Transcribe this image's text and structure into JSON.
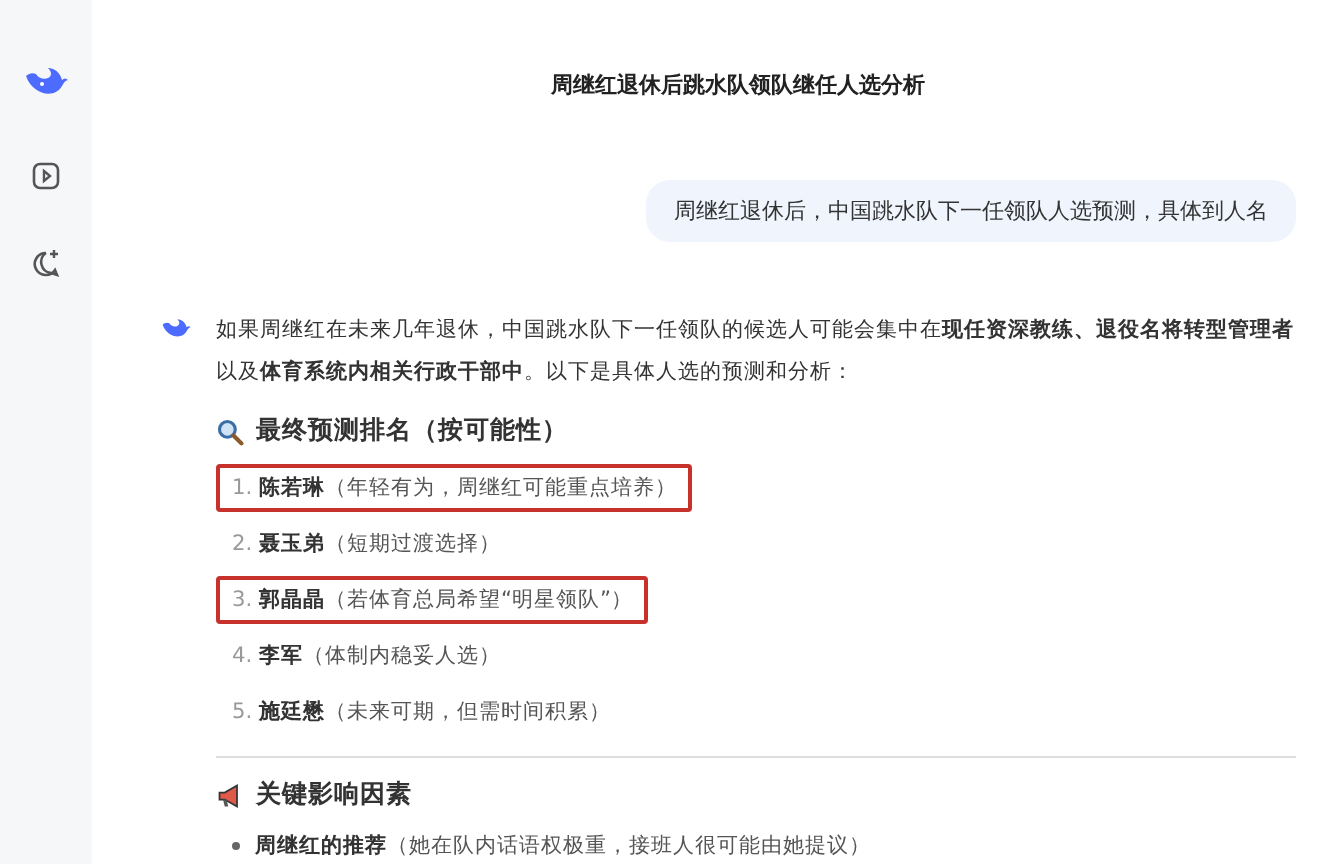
{
  "title": "周继红退休后跳水队领队继任人选分析",
  "user_message": "周继红退休后，中国跳水队下一任领队人选预测，具体到人名",
  "answer": {
    "intro": "如果周继红在未来几年退休，中国跳水队下一任领队的候选人可能会集中在**现任资深教练、退役名将转型管理者**以及**体育系统内相关行政干部中**。以下是具体人选的预测和分析：",
    "ranking_heading": "最终预测排名（按可能性）",
    "ranking": [
      {
        "number": "1.",
        "name": "陈若琳",
        "note": "（年轻有为，周继红可能重点培养）",
        "highlighted": true
      },
      {
        "number": "2.",
        "name": "聂玉弟",
        "note": "（短期过渡选择）",
        "highlighted": false
      },
      {
        "number": "3.",
        "name": "郭晶晶",
        "note": "（若体育总局希望“明星领队”）",
        "highlighted": true
      },
      {
        "number": "4.",
        "name": "李军",
        "note": "（体制内稳妥人选）",
        "highlighted": false
      },
      {
        "number": "5.",
        "name": "施廷懋",
        "note": "（未来可期，但需时间积累）",
        "highlighted": false
      }
    ],
    "factors_heading": "关键影响因素",
    "factors": [
      {
        "name": "周继红的推荐",
        "note": "（她在队内话语权极重，接班人很可能由她提议）"
      }
    ]
  }
}
